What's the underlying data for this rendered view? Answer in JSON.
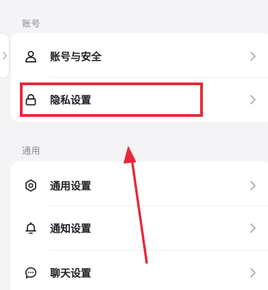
{
  "sections": {
    "account": {
      "title": "账号",
      "items": [
        {
          "label": "账号与安全",
          "icon": "user-icon"
        },
        {
          "label": "隐私设置",
          "icon": "lock-icon"
        }
      ]
    },
    "general": {
      "title": "通用",
      "items": [
        {
          "label": "通用设置",
          "icon": "gear-icon"
        },
        {
          "label": "通知设置",
          "icon": "bell-icon"
        },
        {
          "label": "聊天设置",
          "icon": "chat-icon"
        }
      ]
    }
  },
  "colors": {
    "annotation": "#e8283a",
    "text": "#1f1f24",
    "muted": "#8a8a90",
    "background": "#f4f4f6",
    "card": "#ffffff"
  }
}
